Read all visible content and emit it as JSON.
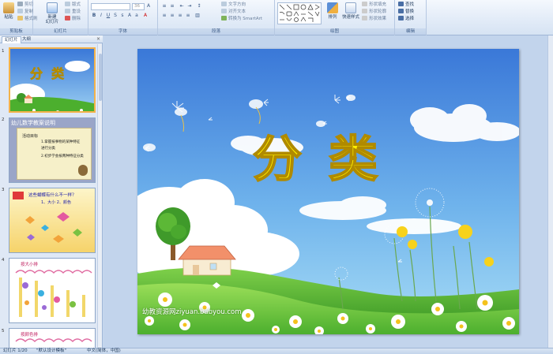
{
  "ribbon": {
    "clipboard": {
      "label": "剪贴板",
      "paste": "粘贴",
      "cut": "剪切",
      "copy": "复制",
      "format_painter": "格式刷"
    },
    "slides": {
      "label": "幻灯片",
      "new_slide": "新建\n幻灯片",
      "layout": "版式",
      "reset": "重设",
      "delete": "删除"
    },
    "font": {
      "label": "字体",
      "font_name": "",
      "font_size": "36"
    },
    "paragraph": {
      "label": "段落",
      "text_direction": "文字方向",
      "align_text": "对齐文本",
      "smartart": "转换为 SmartArt"
    },
    "drawing": {
      "label": "绘图",
      "arrange": "排列",
      "quick_styles": "快速样式",
      "shape_fill": "形状填充",
      "shape_outline": "形状轮廓",
      "shape_effects": "形状效果"
    },
    "editing": {
      "label": "编辑",
      "find": "查找",
      "replace": "替换",
      "select": "选择"
    }
  },
  "panel": {
    "tab_slides": "幻灯片",
    "tab_outline": "大纲",
    "close": "×"
  },
  "thumbnails": [
    {
      "num": "1",
      "title": "分  类"
    },
    {
      "num": "2",
      "title": "幼儿数学教案说明"
    },
    {
      "num": "3",
      "title": "这些蝴蝶有什么不一样？",
      "subtitle": "1、大小  2、颜色"
    },
    {
      "num": "4",
      "title": "按大小排"
    },
    {
      "num": "5",
      "title": "按颜色排"
    }
  ],
  "thumb2_lines": [
    "活动目标",
    "1.掌握按事物的某种特征",
    "进行分类",
    "2.初步学会按两种特征分类"
  ],
  "slide": {
    "title": "分类",
    "watermark": "幼教资源网ziyuan.babyou.com"
  },
  "status": {
    "slide_count": "幻灯片 1/20",
    "theme": "\"默认设计模板\"",
    "language": "中文(简体，中国)"
  },
  "colors": {
    "sky_top": "#3a78d8",
    "sky_bottom": "#8ecbf0",
    "title_fill": "#fff000",
    "grass": "#4caf2e"
  }
}
